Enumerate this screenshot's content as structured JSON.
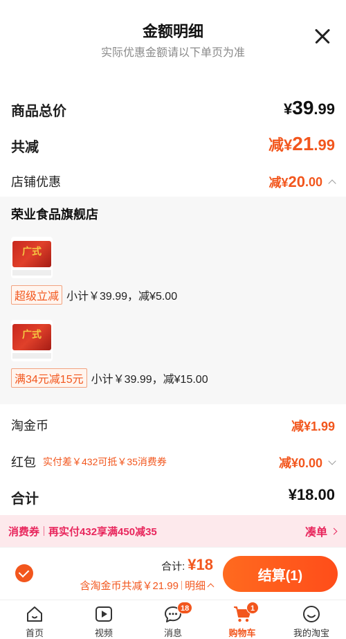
{
  "header": {
    "title": "金额明细",
    "subtitle": "实际优惠金额请以下单页为准"
  },
  "summary": {
    "total_label": "商品总价",
    "total_currency": "¥",
    "total_int": "39",
    "total_dec": ".99",
    "reduce_label": "共减",
    "reduce_prefix": "减¥",
    "reduce_int": "21",
    "reduce_dec": ".99",
    "store_discount_label": "店铺优惠",
    "store_discount_prefix": "减¥",
    "store_discount_int": "20",
    "store_discount_dec": ".00"
  },
  "store": {
    "name": "荣业食品旗舰店",
    "products": [
      {
        "thumb_text": "广式",
        "tag": "超级立减",
        "detail": "小计￥39.99，减¥5.00"
      },
      {
        "thumb_text": "广式",
        "tag": "满34元减15元",
        "detail": "小计￥39.99，减¥15.00"
      }
    ]
  },
  "coin": {
    "label": "淘金币",
    "value": "减¥1.99"
  },
  "red_packet": {
    "label": "红包",
    "hint": "实付差￥432可抵￥35消费券",
    "value": "减¥0.00"
  },
  "sum": {
    "label": "合计",
    "value": "¥18.00"
  },
  "promo": {
    "tag": "消费券",
    "message": "再实付432享满450减35",
    "link": "凑单"
  },
  "checkout": {
    "sum_label": "合计:",
    "sum_amount": "¥18",
    "detail_text": "含淘金币共减￥21.99",
    "detail_link": "明细",
    "pay_button": "结算(1)"
  },
  "tabbar": {
    "items": [
      {
        "label": "首页",
        "icon": "home-icon"
      },
      {
        "label": "视频",
        "icon": "video-icon"
      },
      {
        "label": "消息",
        "icon": "message-icon",
        "badge": "18"
      },
      {
        "label": "购物车",
        "icon": "cart-icon",
        "badge": "1"
      },
      {
        "label": "我的淘宝",
        "icon": "profile-icon"
      }
    ]
  },
  "colors": {
    "accent": "#f2561d",
    "promo_pink": "#e8265c",
    "promo_bg": "#fde9ec",
    "store_bg": "#f7f7f7"
  }
}
